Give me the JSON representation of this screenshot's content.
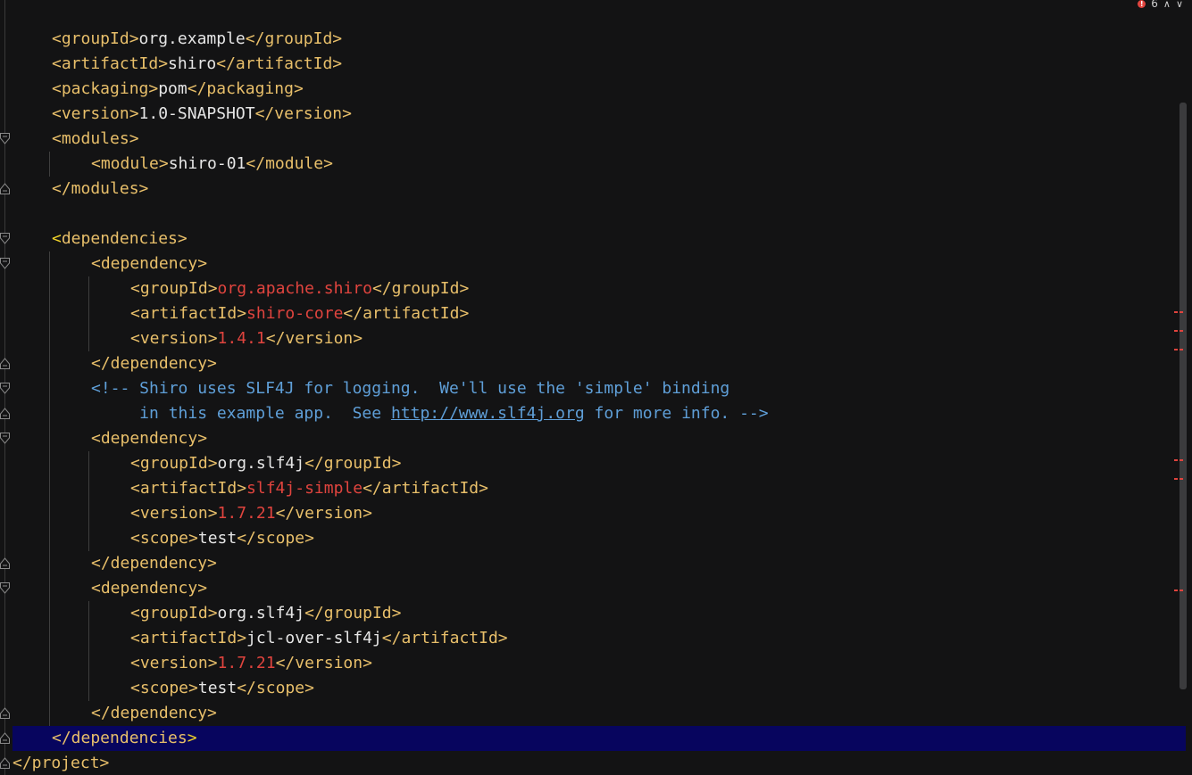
{
  "status": {
    "error_count": "6",
    "prev_icon": "chevron-up-icon",
    "next_icon": "chevron-down-icon"
  },
  "code": {
    "l1": {
      "o": "<groupId>",
      "t": "org.example",
      "c": "</groupId>"
    },
    "l2": {
      "o": "<artifactId>",
      "t": "shiro",
      "c": "</artifactId>"
    },
    "l3": {
      "o": "<packaging>",
      "t": "pom",
      "c": "</packaging>"
    },
    "l4": {
      "o": "<version>",
      "t": "1.0-SNAPSHOT",
      "c": "</version>"
    },
    "l5": {
      "o": "<modules>"
    },
    "l6": {
      "o": "<module>",
      "t": "shiro-01",
      "c": "</module>"
    },
    "l7": {
      "o": "</modules>"
    },
    "l9": {
      "b": "<",
      "o": "dependencies>"
    },
    "l10": {
      "o": "<dependency>"
    },
    "l11": {
      "o": "<groupId>",
      "t": "org.apache.shiro",
      "c": "</groupId>"
    },
    "l12": {
      "o": "<artifactId>",
      "t": "shiro-core",
      "c": "</artifactId>"
    },
    "l13": {
      "o": "<version>",
      "t": "1.4.1",
      "c": "</version>"
    },
    "l14": {
      "o": "</dependency>"
    },
    "l15": {
      "cm": "<!-- Shiro uses SLF4J for logging.  We'll use the 'simple' binding"
    },
    "l16": {
      "cm1": "     in this example app.  See ",
      "url": "http://www.slf4j.org",
      "cm2": " for more info. -->"
    },
    "l17": {
      "o": "<dependency>"
    },
    "l18": {
      "o": "<groupId>",
      "t": "org.slf4j",
      "c": "</groupId>"
    },
    "l19": {
      "o": "<artifactId>",
      "t": "slf4j-simple",
      "c": "</artifactId>"
    },
    "l20": {
      "o": "<version>",
      "t": "1.7.21",
      "c": "</version>"
    },
    "l21": {
      "o": "<scope>",
      "t": "test",
      "c": "</scope>"
    },
    "l22": {
      "o": "</dependency>"
    },
    "l23": {
      "o": "<dependency>"
    },
    "l24": {
      "o": "<groupId>",
      "t": "org.slf4j",
      "c": "</groupId>"
    },
    "l25": {
      "o": "<artifactId>",
      "t": "jcl-over-slf4j",
      "c": "</artifactId>"
    },
    "l26": {
      "o": "<version>",
      "t": "1.7.21",
      "c": "</version>"
    },
    "l27": {
      "o": "<scope>",
      "t": "test",
      "c": "</scope>"
    },
    "l28": {
      "o": "</dependency>"
    },
    "l29": {
      "o": "</dependencies",
      "b": ">"
    },
    "l30": {
      "o": "</project>"
    }
  },
  "colors": {
    "background": "#131314",
    "tag": "#e8bf6a",
    "error_text": "#e0443e",
    "comment": "#5f9fd8",
    "current_line": "#07055e"
  }
}
